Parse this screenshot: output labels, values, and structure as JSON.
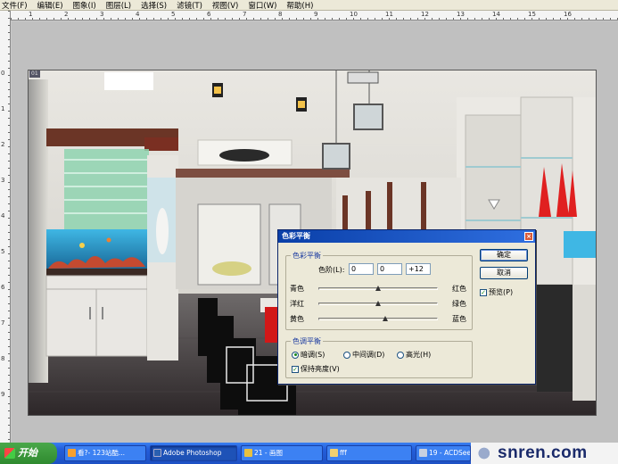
{
  "menu": [
    "文件(F)",
    "编辑(E)",
    "图象(I)",
    "图层(L)",
    "选择(S)",
    "滤镜(T)",
    "视图(V)",
    "窗口(W)",
    "帮助(H)"
  ],
  "ruler_top": [
    "1",
    "2",
    "3",
    "4",
    "5",
    "6",
    "7",
    "8",
    "9",
    "10",
    "11",
    "12",
    "13",
    "14",
    "15",
    "16"
  ],
  "ruler_left": [
    "0",
    "1",
    "2",
    "3",
    "4",
    "5",
    "6",
    "7",
    "8",
    "9"
  ],
  "document": {
    "tab": "01"
  },
  "dialog": {
    "title": "色彩平衡",
    "close": "×",
    "balance_group": "色彩平衡",
    "levels_label": "色阶(L):",
    "levels": [
      "0",
      "0",
      "+12"
    ],
    "sliders": [
      {
        "left": "青色",
        "right": "红色",
        "value": 0
      },
      {
        "left": "洋红",
        "right": "绿色",
        "value": 0
      },
      {
        "left": "黄色",
        "right": "蓝色",
        "value": 12
      }
    ],
    "tone_group": "色调平衡",
    "tones": [
      {
        "label": "暗调(S)",
        "selected": true
      },
      {
        "label": "中间调(D)",
        "selected": false
      },
      {
        "label": "高光(H)",
        "selected": false
      }
    ],
    "preserve": {
      "label": "保持亮度(V)",
      "checked": true
    },
    "ok": "确定",
    "cancel": "取消",
    "preview": {
      "label": "预览(P)",
      "checked": true
    }
  },
  "taskbar": {
    "start": "开始",
    "tasks": [
      {
        "label": "看?- 123站酷...",
        "active": false
      },
      {
        "label": "Adobe Photoshop",
        "active": true
      },
      {
        "label": "21 - 画图",
        "active": false
      },
      {
        "label": "fff",
        "active": false
      },
      {
        "label": "19 - ACDSee",
        "active": false
      }
    ]
  },
  "watermark": "snren.com",
  "colors": {
    "taskbar": "#245edb",
    "title_gradient": "#0a3fa8",
    "dialog_bg": "#ece9d8",
    "start": "#2f8a2f"
  }
}
